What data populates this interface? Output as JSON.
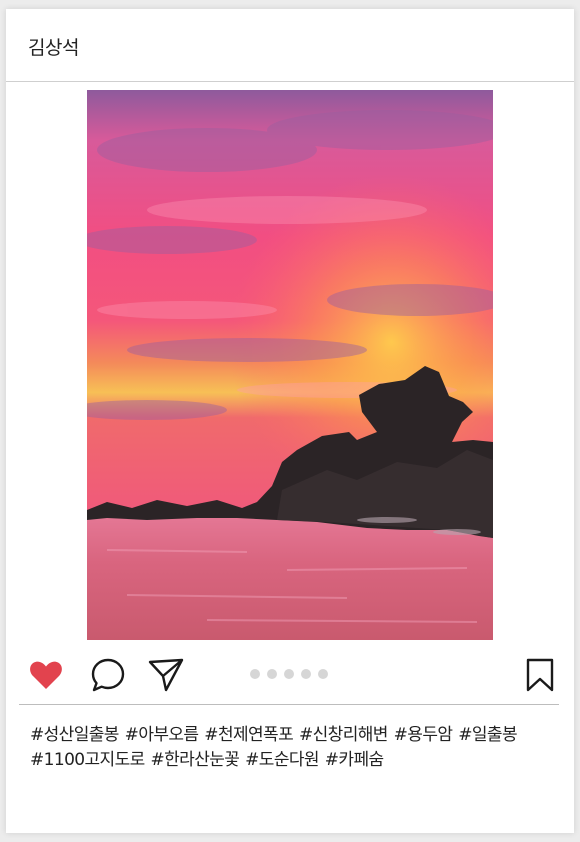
{
  "post": {
    "username": "김상석",
    "photo_icon": "sunset-rock-photo",
    "carousel": {
      "count": 5,
      "active_index": 0
    },
    "action_icons": [
      "heart-icon",
      "comment-icon",
      "share-icon",
      "bookmark-icon"
    ],
    "liked": true,
    "colors": {
      "like": "#e2434e",
      "dot": "#d6d6d6",
      "text": "#222222"
    },
    "hashtags": [
      "#성산일출봉",
      "#아부오름",
      "#천제연폭포",
      "#신창리해변",
      "#용두암",
      "#일출봉",
      "#1100고지도로",
      "#한라산눈꽃",
      "#도순다원",
      "#카페숨"
    ]
  }
}
